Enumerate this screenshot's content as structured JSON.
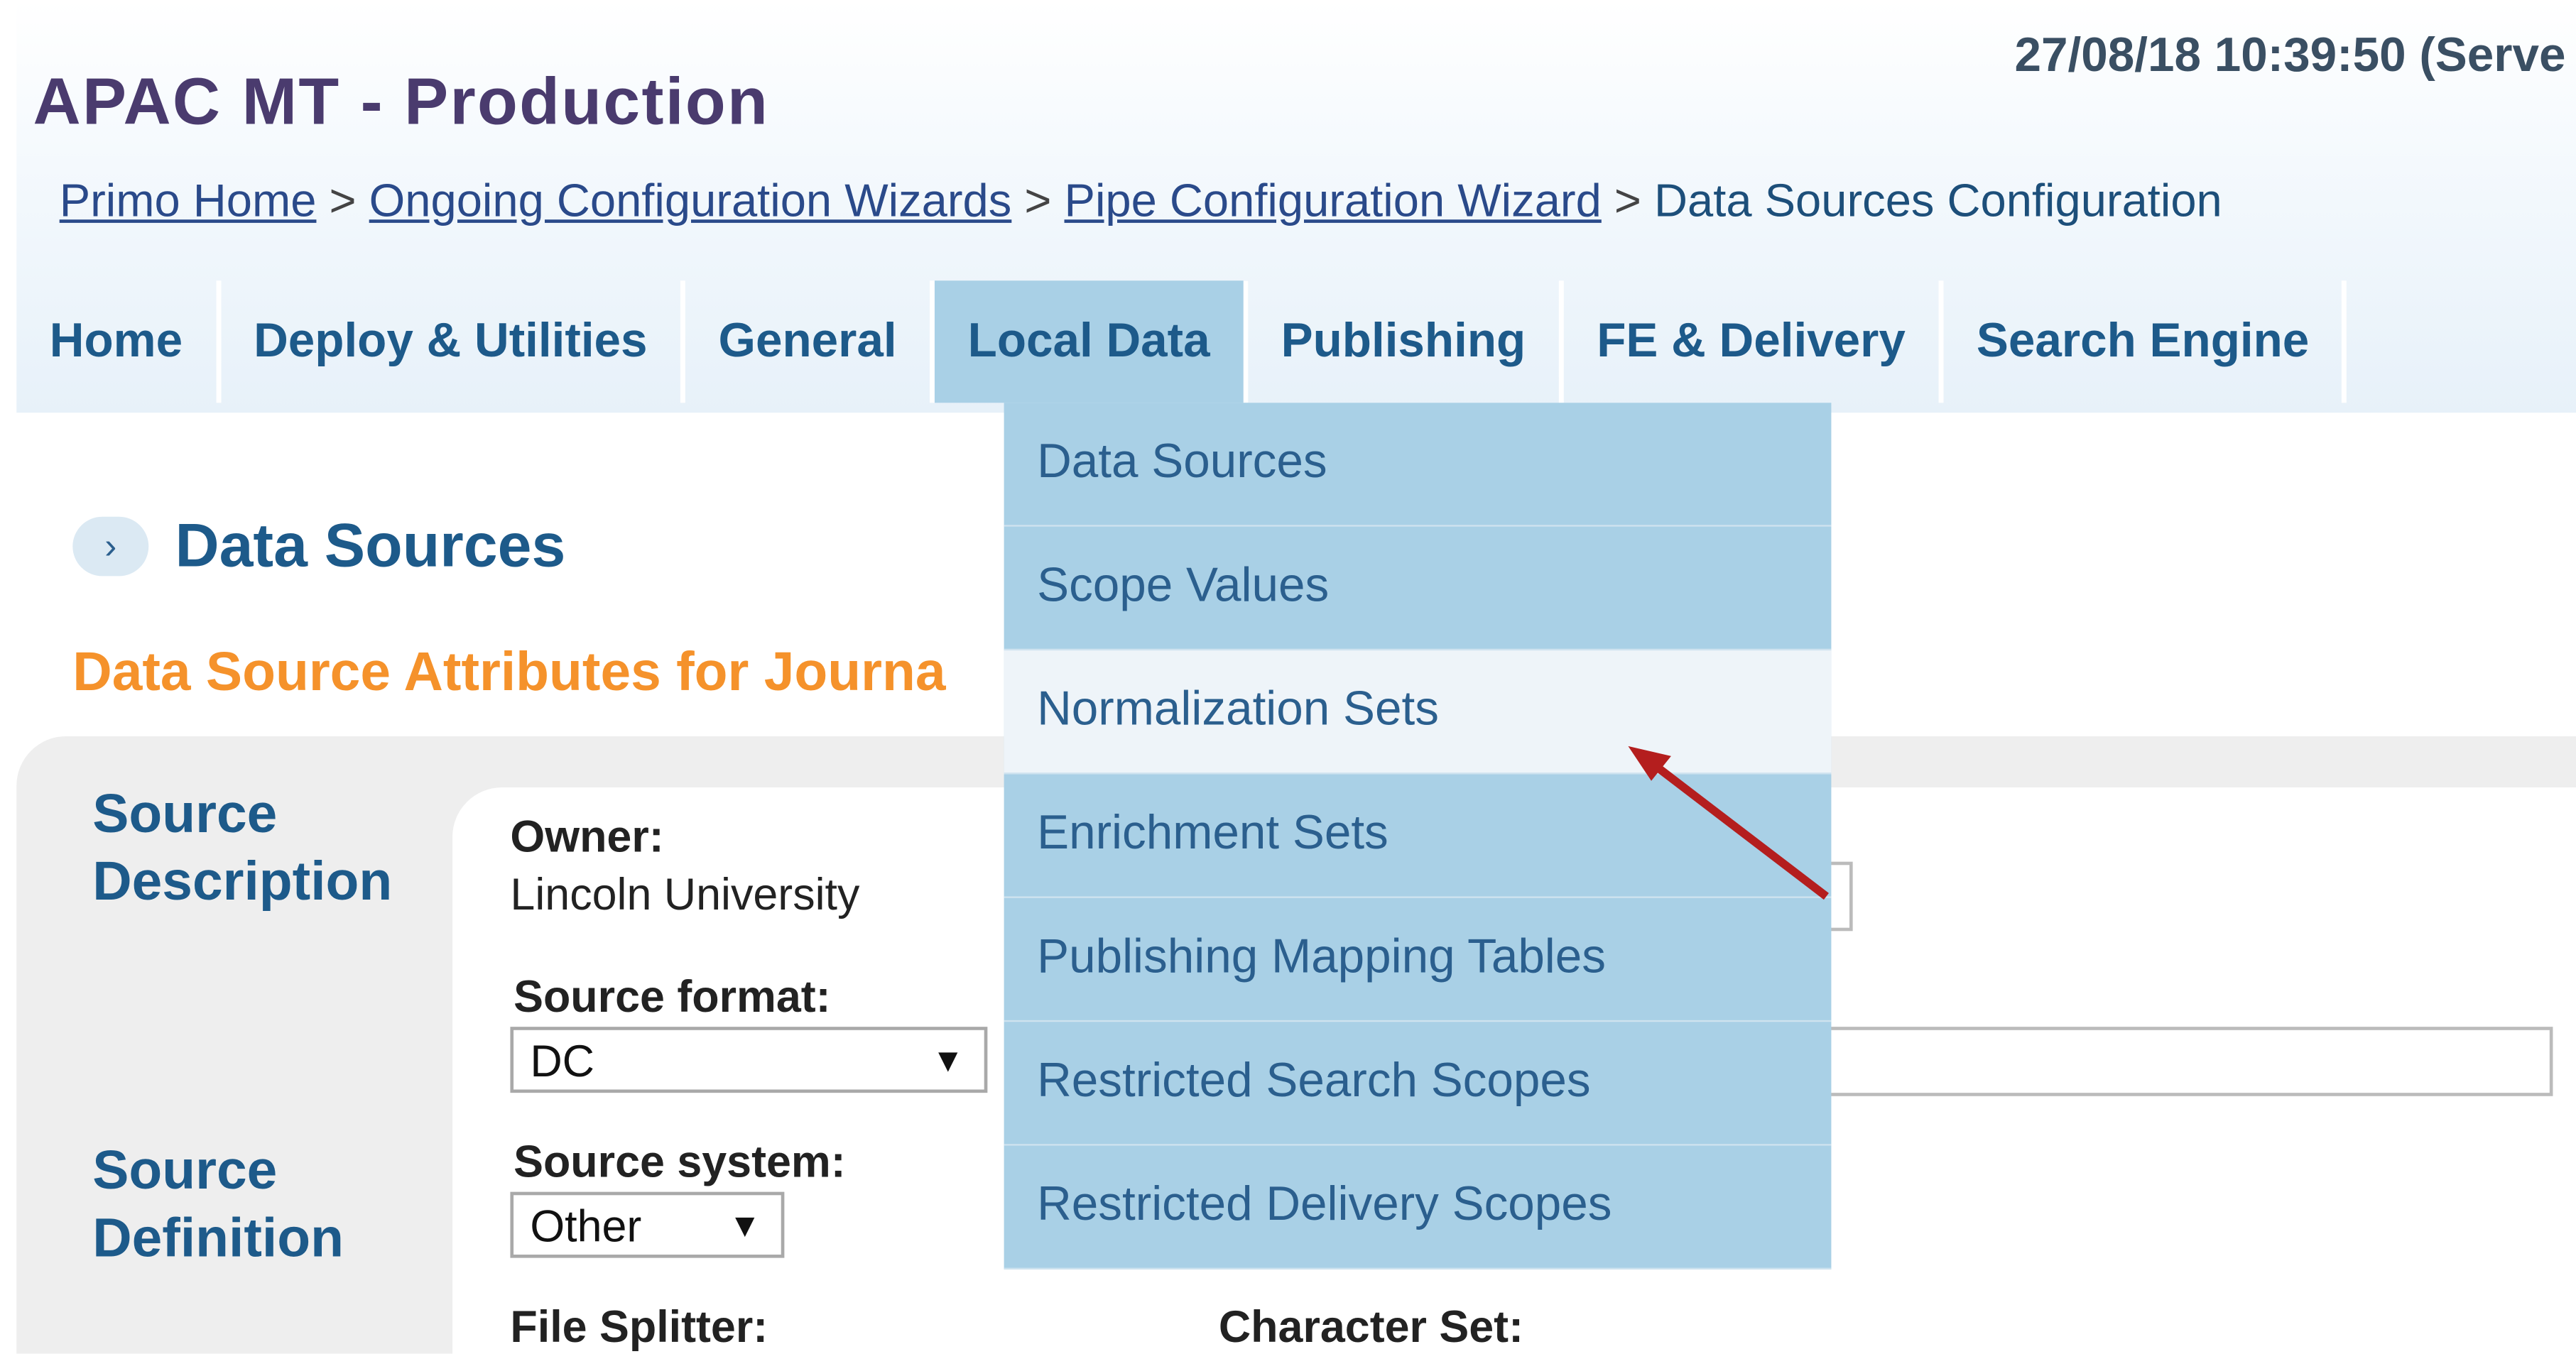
{
  "header": {
    "title": "APAC MT - Production",
    "datetime": "27/08/18 10:39:50 (Serve"
  },
  "breadcrumb": {
    "items": [
      "Primo Home",
      "Ongoing Configuration Wizards",
      "Pipe Configuration Wizard"
    ],
    "separator": ">",
    "current": "Data Sources Configuration"
  },
  "nav": {
    "tabs": [
      "Home",
      "Deploy & Utilities",
      "General",
      "Local Data",
      "Publishing",
      "FE & Delivery",
      "Search Engine"
    ],
    "active": "Local Data"
  },
  "dropdown": {
    "items": [
      "Data Sources",
      "Scope Values",
      "Normalization Sets",
      "Enrichment Sets",
      "Publishing Mapping Tables",
      "Restricted Search Scopes",
      "Restricted Delivery Scopes"
    ],
    "highlighted": "Normalization Sets"
  },
  "page": {
    "section_title": "Data Sources",
    "subtitle": "Data Source Attributes for Journa"
  },
  "form": {
    "source_description_label": "Source Description",
    "source_definition_label": "Source Definition",
    "owner_label": "Owner:",
    "owner_value": "Lincoln University",
    "source_format_label": "Source format:",
    "source_format_value": "DC",
    "source_system_label": "Source system:",
    "source_system_value": "Other",
    "file_splitter_label": "File Splitter:",
    "character_set_label": "Character Set:",
    "dropdown_arrow": "▼"
  },
  "icons": {
    "chevron": "›"
  },
  "colors": {
    "title": "#4a3b6e",
    "nav_text": "#1d5a8a",
    "menu_bg": "#a9d0e6",
    "subtitle": "#f5922b",
    "annotation_arrow": "#b41e1e"
  }
}
